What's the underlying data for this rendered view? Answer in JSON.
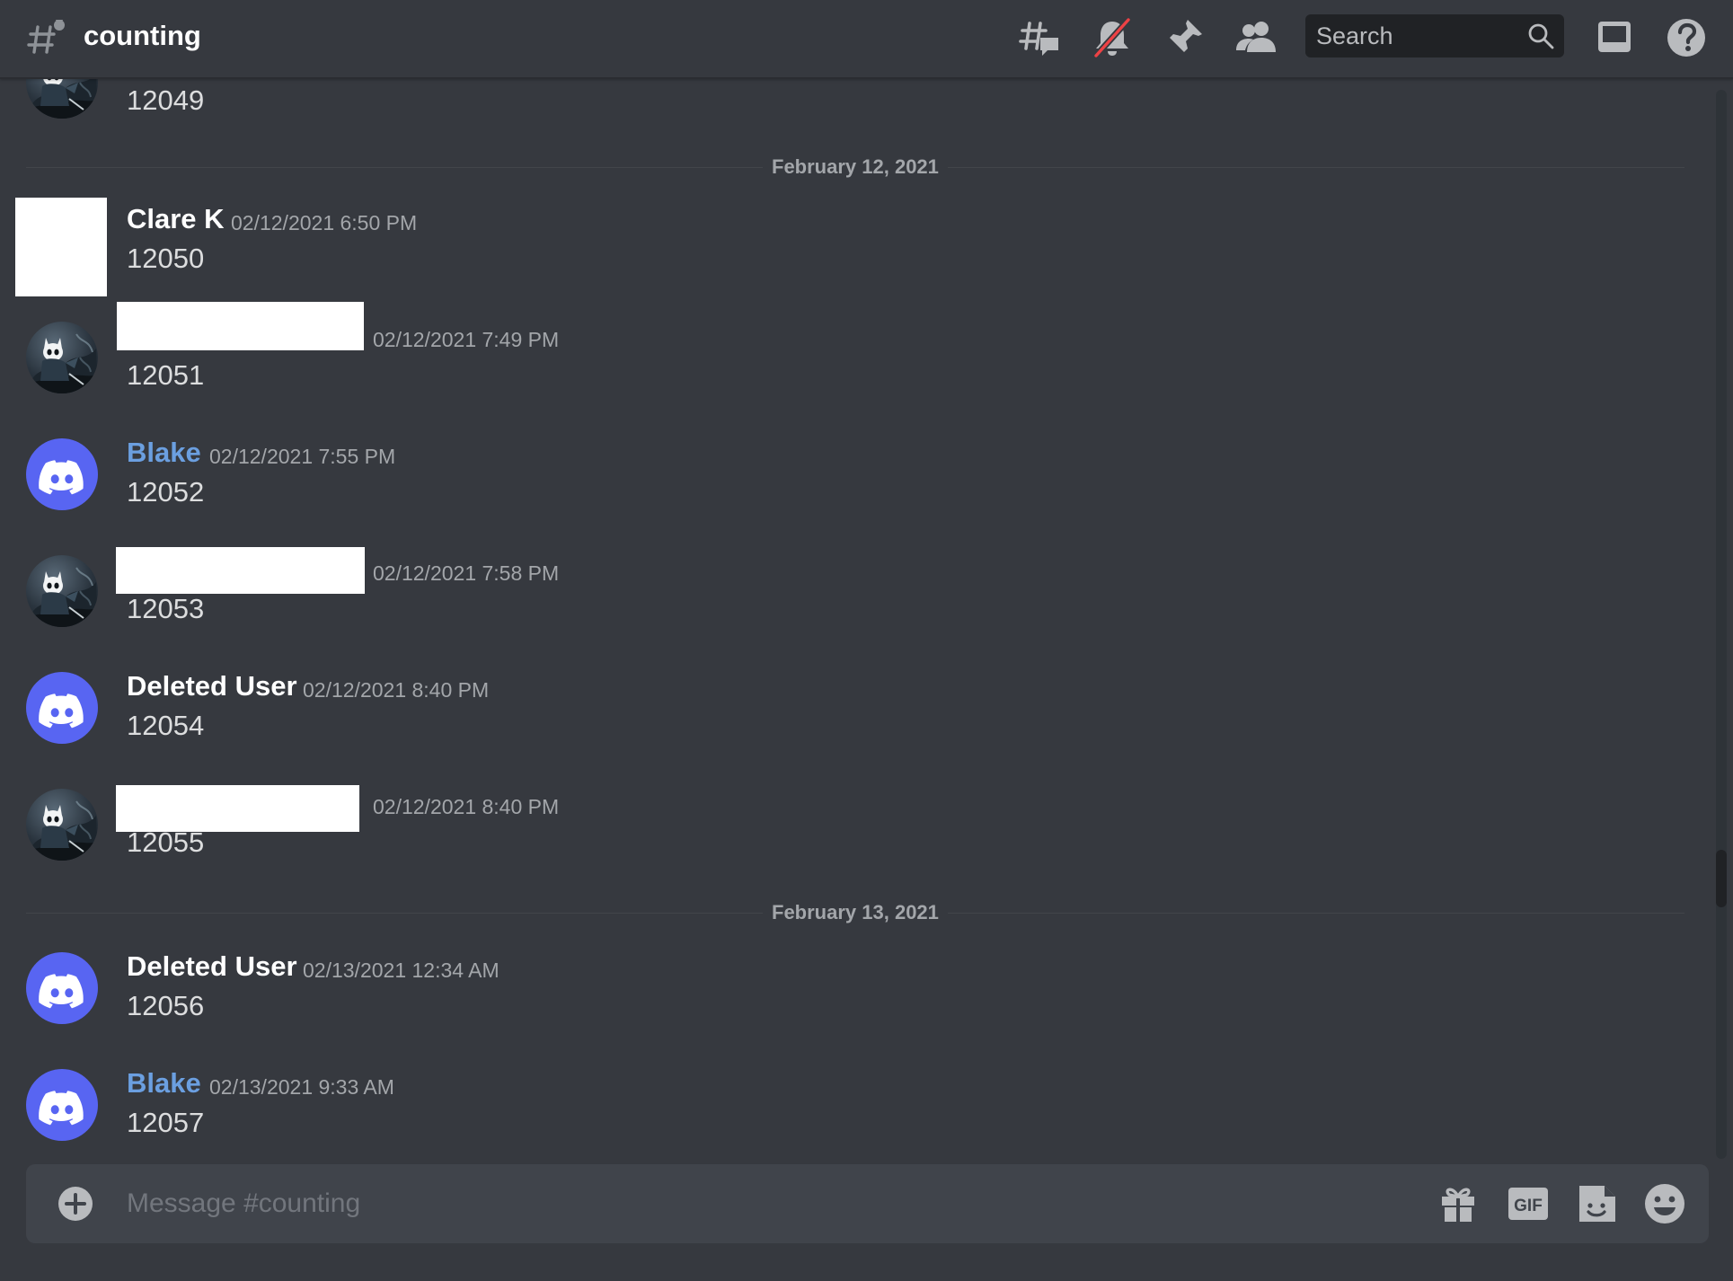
{
  "header": {
    "channel_name": "counting",
    "search_placeholder": "Search"
  },
  "messages": [
    {
      "author": "",
      "timestamp": "",
      "content": "12049"
    },
    {
      "author": "Clare K",
      "timestamp": "02/12/2021 6:50 PM",
      "content": "12050"
    },
    {
      "author": "",
      "timestamp": "02/12/2021 7:49 PM",
      "content": "12051"
    },
    {
      "author": "Blake",
      "timestamp": "02/12/2021 7:55 PM",
      "content": "12052"
    },
    {
      "author": "",
      "timestamp": "02/12/2021 7:58 PM",
      "content": "12053"
    },
    {
      "author": "Deleted User",
      "timestamp": "02/12/2021 8:40 PM",
      "content": "12054"
    },
    {
      "author": "",
      "timestamp": "02/12/2021 8:40 PM",
      "content": "12055"
    },
    {
      "author": "Deleted User",
      "timestamp": "02/13/2021 12:34 AM",
      "content": "12056"
    },
    {
      "author": "Blake",
      "timestamp": "02/13/2021 9:33 AM",
      "content": "12057"
    }
  ],
  "dividers": [
    {
      "label": "February 12, 2021"
    },
    {
      "label": "February 13, 2021"
    }
  ],
  "composer": {
    "placeholder": "Message #counting",
    "gif_label": "GIF"
  },
  "colors": {
    "background": "#36393f",
    "blurple": "#5865f2",
    "username_blue": "#6b9fe0",
    "mute_slash": "#ed4245"
  },
  "icons": {
    "channel": "thread-channel-icon",
    "threads": "threads-icon",
    "mute": "bell-muted-icon",
    "pins": "pin-icon",
    "members": "members-icon",
    "search": "search-icon",
    "inbox": "inbox-icon",
    "help": "help-icon",
    "add": "plus-circle-icon",
    "gift": "gift-icon",
    "gif": "gif-icon",
    "sticker": "sticker-icon",
    "emoji": "emoji-icon"
  }
}
